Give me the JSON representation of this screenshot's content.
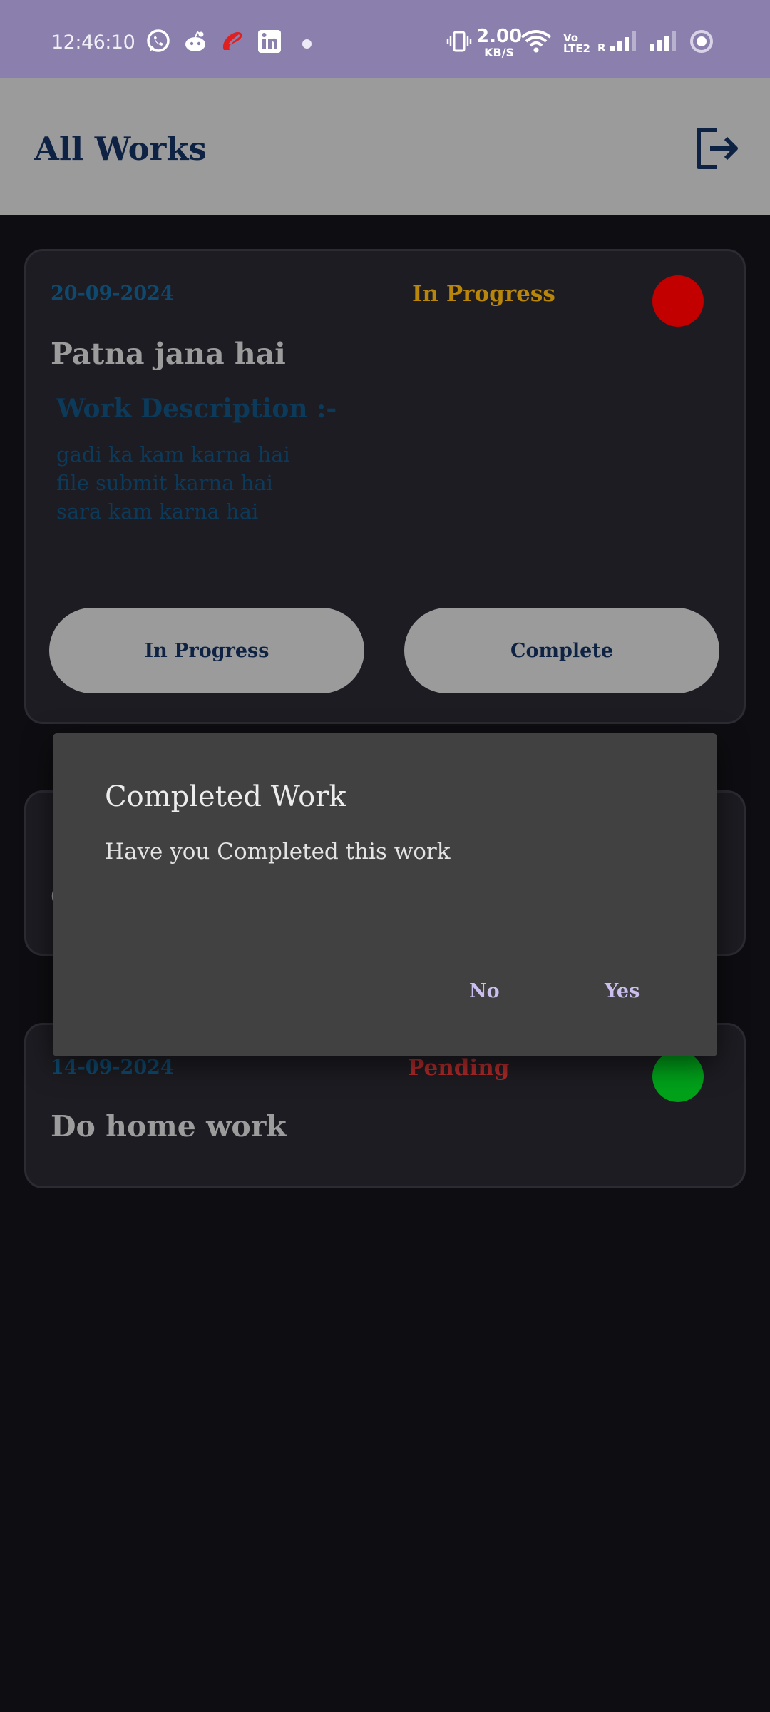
{
  "status_bar": {
    "time": "12:46:10",
    "notification_icons": [
      "whatsapp-icon",
      "reddit-icon",
      "airtel-icon",
      "linkedin-icon",
      "more-dot-icon"
    ],
    "net_speed_value": "2.00",
    "net_speed_unit": "KB/S",
    "volte_top": "Vo",
    "volte_bottom": "LTE2",
    "roaming": "R",
    "system_icons": [
      "vibrate-icon",
      "wifi-icon",
      "signal-icon",
      "signal-icon-2",
      "battery-ring-icon"
    ]
  },
  "app_bar": {
    "title": "All Works",
    "logout_icon": "logout-icon"
  },
  "cards": [
    {
      "date": "20-09-2024",
      "status": "In Progress",
      "status_color": "#b8860b",
      "dot_color": "#c20000",
      "title": "Patna jana hai",
      "description_heading": "Work Description :-",
      "description_lines": [
        "gadi ka kam karna hai",
        "file submit karna hai",
        "sara kam karna hai"
      ],
      "buttons": {
        "in_progress": "In Progress",
        "complete": "Complete"
      }
    },
    {
      "date": "",
      "status": "",
      "title": "C"
    },
    {
      "date": "14-09-2024",
      "status": "Pending",
      "status_color": "#b02a2a",
      "dot_color": "#00a21a",
      "title": "Do home work"
    }
  ],
  "dialog": {
    "title": "Completed Work",
    "message": "Have you Completed this work",
    "no_label": "No",
    "yes_label": "Yes"
  },
  "colors": {
    "status_bar_bg": "#8b80ad",
    "app_bar_bg": "#9b9b9b",
    "page_bg": "#0e0d11",
    "card_bg": "#1d1c22",
    "dialog_bg": "#414141",
    "dialog_button": "#cbbff0",
    "title_navy": "#0e2244"
  }
}
